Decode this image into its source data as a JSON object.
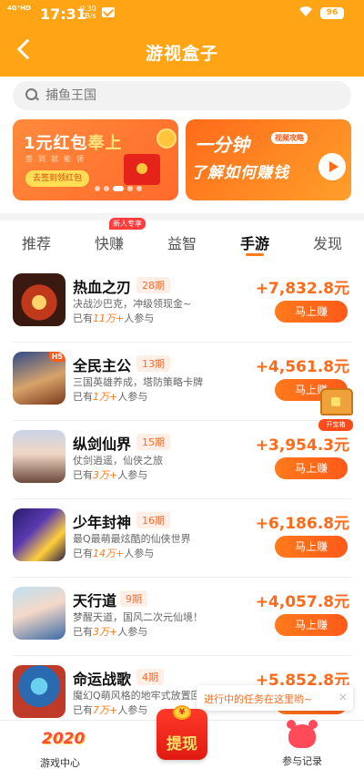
{
  "status_bar": {
    "network": "4G⁺HD",
    "time": "17:31",
    "speed": "0.30\nKB/s",
    "battery": "96"
  },
  "header": {
    "title": "游视盒子"
  },
  "search": {
    "placeholder": "捕鱼王国"
  },
  "banners": {
    "left": {
      "title_prefix": "1元红包",
      "title_highlight": "奉上",
      "subtitle": "签到就能领",
      "button": "去签到领红包"
    },
    "right": {
      "title1": "一分钟",
      "tag": "视频攻略",
      "title2": "了解如何赚钱"
    }
  },
  "tabs": [
    {
      "label": "推荐"
    },
    {
      "label": "快赚",
      "badge": "新人专享"
    },
    {
      "label": "益智"
    },
    {
      "label": "手游",
      "active": true
    },
    {
      "label": "发现"
    }
  ],
  "games": [
    {
      "name": "热血之刃",
      "period": "28期",
      "desc": "决战沙巴克，冲级领现金~",
      "players_prefix": "已有",
      "players_count": "11万+",
      "players_suffix": "人参与",
      "reward": "+7,832.8元",
      "button": "马上赚"
    },
    {
      "name": "全民主公",
      "period": "13期",
      "desc": "三国英雄养成，塔防策略卡牌",
      "players_prefix": "已有",
      "players_count": "1万+",
      "players_suffix": "人参与",
      "reward": "+4,561.8元",
      "button": "马上赚",
      "tag": "H5"
    },
    {
      "name": "纵剑仙界",
      "period": "15期",
      "desc": "仗剑逍遥，仙侠之旅",
      "players_prefix": "已有",
      "players_count": "3万+",
      "players_suffix": "人参与",
      "reward": "+3,954.3元",
      "button": "马上赚"
    },
    {
      "name": "少年封神",
      "period": "16期",
      "desc": "最Q最萌最炫酷的仙侠世界",
      "players_prefix": "已有",
      "players_count": "14万+",
      "players_suffix": "人参与",
      "reward": "+6,186.8元",
      "button": "马上赚"
    },
    {
      "name": "天行道",
      "period": "9期",
      "desc": "梦醒天道，国风二次元仙境！",
      "players_prefix": "已有",
      "players_count": "3万+",
      "players_suffix": "人参与",
      "reward": "+4,057.8元",
      "button": "马上赚"
    },
    {
      "name": "命运战歌",
      "period": "4期",
      "desc": "魔幻Q萌风格的地牢式放置回合手游",
      "players_prefix": "已有",
      "players_count": "7万+",
      "players_suffix": "人参与",
      "reward": "+5,852.8元",
      "button": "马上赚"
    }
  ],
  "floating_chest": {
    "label": "开宝箱"
  },
  "task_tip": {
    "text": "进行中的任务在这里哟~",
    "close": "×"
  },
  "bottom_nav": {
    "left": {
      "label": "游戏中心",
      "icon_text": "2020"
    },
    "center": {
      "label": "提现",
      "coin": "¥"
    },
    "right": {
      "label": "参与记录"
    }
  },
  "colors": {
    "brand": "#ffa515",
    "accent": "#ff6a1a"
  }
}
